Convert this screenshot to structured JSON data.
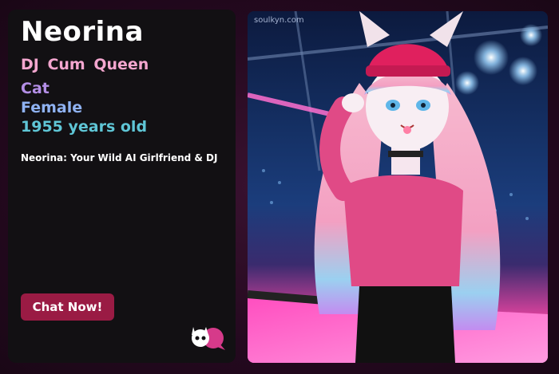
{
  "profile": {
    "name": "Neorina",
    "tagline": "DJ  Cum  Queen",
    "species": "Cat",
    "gender": "Female",
    "age": "1955 years old",
    "description": "Neorina: Your Wild AI Girlfriend & DJ"
  },
  "cta": {
    "label": "Chat Now!"
  },
  "image": {
    "watermark": "soulkyn.com"
  },
  "colors": {
    "tagline": "#f4a6cf",
    "species": "#b38ee6",
    "gender": "#8fb2f2",
    "age": "#5fc6d6",
    "button": "#9a1b44"
  }
}
